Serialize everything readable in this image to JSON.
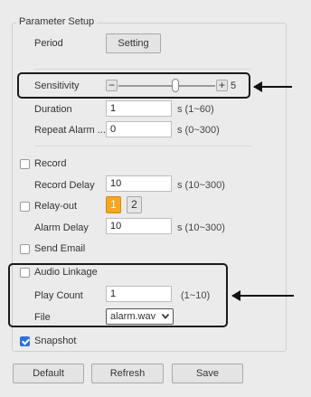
{
  "legend": "Parameter Setup",
  "period": {
    "label": "Period",
    "button": "Setting"
  },
  "sensitivity": {
    "label": "Sensitivity",
    "minus": "−",
    "plus": "+",
    "value": "5",
    "level": 0.6
  },
  "duration": {
    "label": "Duration",
    "value": "1",
    "unit": "s (1~60)"
  },
  "repeat_alarm": {
    "label": "Repeat Alarm ...",
    "value": "0",
    "unit": "s (0~300)"
  },
  "record": {
    "label": "Record",
    "checked": false
  },
  "record_delay": {
    "label": "Record Delay",
    "value": "10",
    "unit": "s (10~300)"
  },
  "relay_out": {
    "label": "Relay-out",
    "checked": false,
    "options": [
      "1",
      "2"
    ],
    "active": "1"
  },
  "alarm_delay": {
    "label": "Alarm Delay",
    "value": "10",
    "unit": "s (10~300)"
  },
  "send_email": {
    "label": "Send Email",
    "checked": false
  },
  "audio_linkage": {
    "label": "Audio Linkage",
    "checked": false
  },
  "play_count": {
    "label": "Play Count",
    "value": "1",
    "unit": "(1~10)"
  },
  "file": {
    "label": "File",
    "value": "alarm.wav"
  },
  "snapshot": {
    "label": "Snapshot",
    "checked": true
  },
  "buttons": {
    "default": "Default",
    "refresh": "Refresh",
    "save": "Save"
  },
  "colors": {
    "accent": "#2f6fd8",
    "active_relay": "#f5a623",
    "highlight": "#1a1a1a"
  }
}
